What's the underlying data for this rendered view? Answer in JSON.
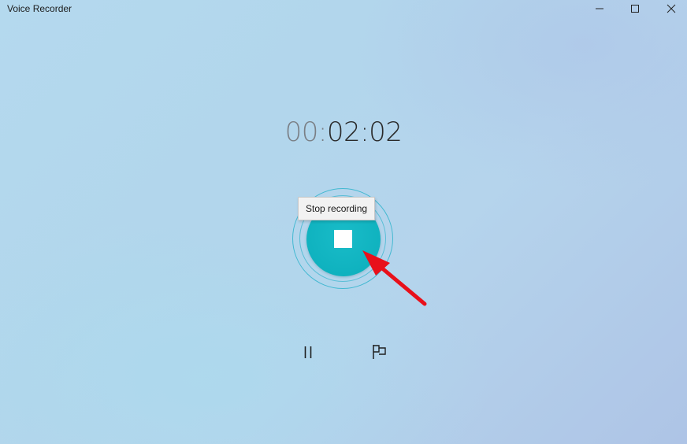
{
  "window": {
    "title": "Voice Recorder",
    "controls": {
      "minimize_icon": "minimize-icon",
      "maximize_icon": "maximize-icon",
      "close_icon": "close-icon"
    }
  },
  "timer": {
    "dim_part": "00:",
    "active_part": "02:02"
  },
  "stop_button": {
    "tooltip": "Stop recording",
    "icon": "stop-icon",
    "accent_color": "#12b4c1"
  },
  "controls": {
    "pause_icon": "pause-icon",
    "flag_icon": "flag-icon"
  },
  "annotation": {
    "arrow_color": "#e8101a"
  }
}
